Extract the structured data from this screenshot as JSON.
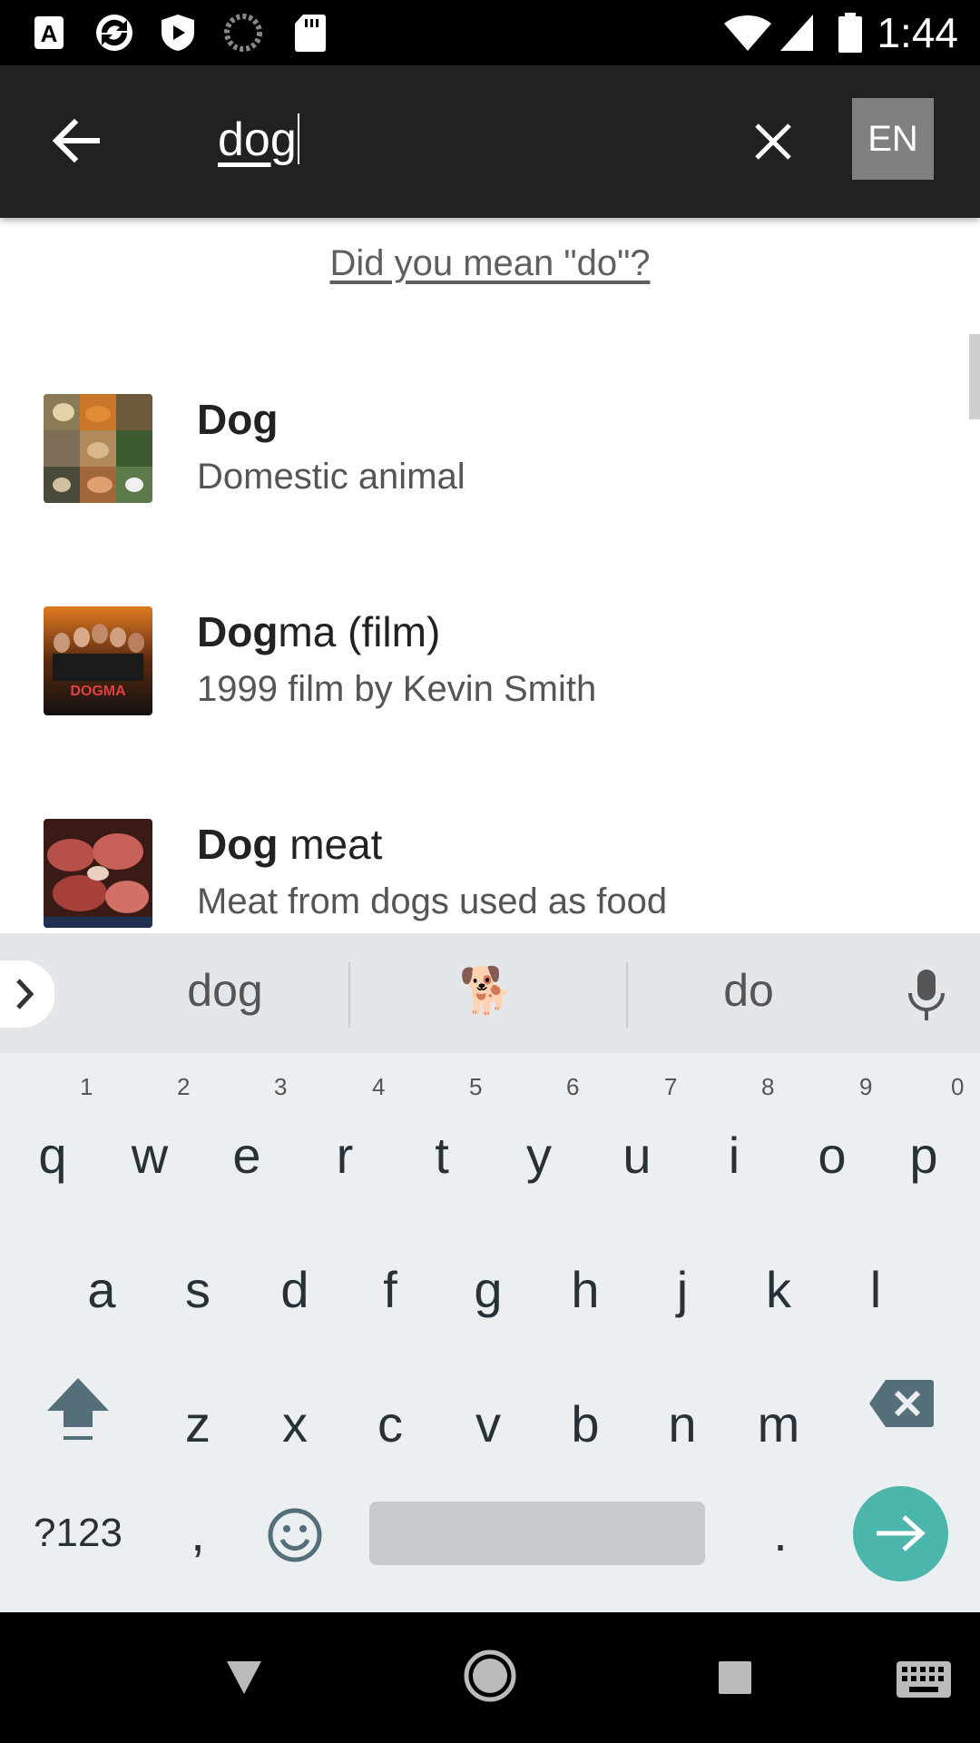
{
  "status_bar": {
    "time": "1:44"
  },
  "toolbar": {
    "query": "dog",
    "lang_label": "EN"
  },
  "did_you_mean": "Did you mean \"do\"?",
  "results": [
    {
      "title_bold": "Dog",
      "title_rest": "",
      "subtitle": "Domestic animal"
    },
    {
      "title_bold": "Dog",
      "title_rest": "ma (film)",
      "subtitle": "1999 film by Kevin Smith"
    },
    {
      "title_bold": "Dog",
      "title_rest": " meat",
      "subtitle": "Meat from dogs used as food"
    }
  ],
  "keyboard": {
    "suggestions": [
      "dog",
      "🐕",
      "do"
    ],
    "row1": [
      "q",
      "w",
      "e",
      "r",
      "t",
      "y",
      "u",
      "i",
      "o",
      "p"
    ],
    "row1_numbers": [
      "1",
      "2",
      "3",
      "4",
      "5",
      "6",
      "7",
      "8",
      "9",
      "0"
    ],
    "row2": [
      "a",
      "s",
      "d",
      "f",
      "g",
      "h",
      "j",
      "k",
      "l"
    ],
    "row3": [
      "z",
      "x",
      "c",
      "v",
      "b",
      "n",
      "m"
    ],
    "symbols_label": "?123",
    "comma": ",",
    "period": "."
  },
  "colors": {
    "accent": "#4db6ac",
    "toolbar_bg": "#212121",
    "lang_bg": "#808080"
  }
}
